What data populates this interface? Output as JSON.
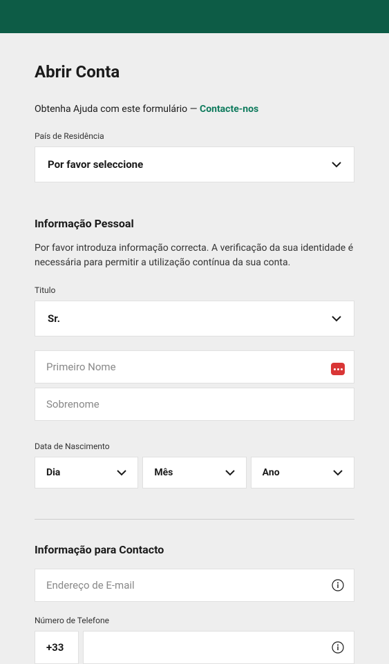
{
  "page": {
    "title": "Abrir Conta",
    "help_prefix": "Obtenha Ajuda com este formulário — ",
    "help_link": "Contacte-nos"
  },
  "residence": {
    "label": "País de Residência",
    "placeholder": "Por favor seleccione"
  },
  "personal": {
    "title": "Informação Pessoal",
    "desc": "Por favor introduza informação correcta. A verificação da sua identidade é necessária para permitir a utilização contínua da sua conta.",
    "title_label": "Titulo",
    "title_value": "Sr.",
    "first_name_placeholder": "Primeiro Nome",
    "last_name_placeholder": "Sobrenome",
    "dob_label": "Data de Nascimento",
    "day": "Dia",
    "month": "Mês",
    "year": "Ano"
  },
  "contact": {
    "title": "Informação para Contacto",
    "email_placeholder": "Endereço de E-mail",
    "phone_label": "Número de Telefone",
    "country_code": "+33"
  }
}
